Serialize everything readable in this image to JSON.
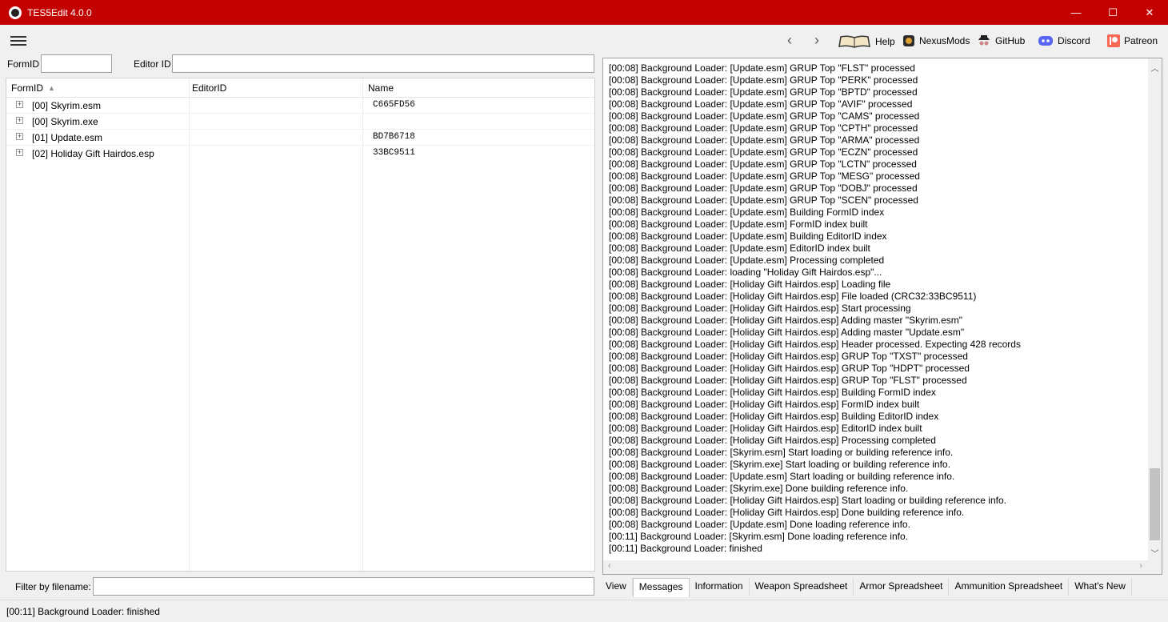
{
  "window": {
    "title": "TES5Edit 4.0.0",
    "minimize": "—",
    "maximize": "☐",
    "close": "✕"
  },
  "toolbar": {
    "back": "‹",
    "forward": "›",
    "help": "Help",
    "nexusmods": "NexusMods",
    "github": "GitHub",
    "discord": "Discord",
    "patreon": "Patreon"
  },
  "filters": {
    "formid_label": "FormID",
    "formid_value": "",
    "editorid_label": "Editor ID",
    "editorid_value": ""
  },
  "tree": {
    "columns": [
      "FormID",
      "EditorID",
      "Name"
    ],
    "sort_indicator": "▲",
    "rows": [
      {
        "name": "[00] Skyrim.esm",
        "hash": "C665FD56"
      },
      {
        "name": "[00] Skyrim.exe",
        "hash": ""
      },
      {
        "name": "[01] Update.esm",
        "hash": "BD7B6718"
      },
      {
        "name": "[02] Holiday Gift Hairdos.esp",
        "hash": "33BC9511"
      }
    ]
  },
  "filename_filter": {
    "label": "Filter by filename:",
    "value": ""
  },
  "messages": [
    "[00:08] Background Loader: [Update.esm] GRUP Top \"FLST\" processed",
    "[00:08] Background Loader: [Update.esm] GRUP Top \"PERK\" processed",
    "[00:08] Background Loader: [Update.esm] GRUP Top \"BPTD\" processed",
    "[00:08] Background Loader: [Update.esm] GRUP Top \"AVIF\" processed",
    "[00:08] Background Loader: [Update.esm] GRUP Top \"CAMS\" processed",
    "[00:08] Background Loader: [Update.esm] GRUP Top \"CPTH\" processed",
    "[00:08] Background Loader: [Update.esm] GRUP Top \"ARMA\" processed",
    "[00:08] Background Loader: [Update.esm] GRUP Top \"ECZN\" processed",
    "[00:08] Background Loader: [Update.esm] GRUP Top \"LCTN\" processed",
    "[00:08] Background Loader: [Update.esm] GRUP Top \"MESG\" processed",
    "[00:08] Background Loader: [Update.esm] GRUP Top \"DOBJ\" processed",
    "[00:08] Background Loader: [Update.esm] GRUP Top \"SCEN\" processed",
    "[00:08] Background Loader: [Update.esm] Building FormID index",
    "[00:08] Background Loader: [Update.esm] FormID index built",
    "[00:08] Background Loader: [Update.esm] Building EditorID index",
    "[00:08] Background Loader: [Update.esm] EditorID index built",
    "[00:08] Background Loader: [Update.esm] Processing completed",
    "[00:08] Background Loader: loading \"Holiday Gift Hairdos.esp\"...",
    "[00:08] Background Loader: [Holiday Gift Hairdos.esp] Loading file",
    "[00:08] Background Loader: [Holiday Gift Hairdos.esp] File loaded (CRC32:33BC9511)",
    "[00:08] Background Loader: [Holiday Gift Hairdos.esp] Start processing",
    "[00:08] Background Loader: [Holiday Gift Hairdos.esp] Adding master \"Skyrim.esm\"",
    "[00:08] Background Loader: [Holiday Gift Hairdos.esp] Adding master \"Update.esm\"",
    "[00:08] Background Loader: [Holiday Gift Hairdos.esp] Header processed. Expecting 428 records",
    "[00:08] Background Loader: [Holiday Gift Hairdos.esp] GRUP Top \"TXST\" processed",
    "[00:08] Background Loader: [Holiday Gift Hairdos.esp] GRUP Top \"HDPT\" processed",
    "[00:08] Background Loader: [Holiday Gift Hairdos.esp] GRUP Top \"FLST\" processed",
    "[00:08] Background Loader: [Holiday Gift Hairdos.esp] Building FormID index",
    "[00:08] Background Loader: [Holiday Gift Hairdos.esp] FormID index built",
    "[00:08] Background Loader: [Holiday Gift Hairdos.esp] Building EditorID index",
    "[00:08] Background Loader: [Holiday Gift Hairdos.esp] EditorID index built",
    "[00:08] Background Loader: [Holiday Gift Hairdos.esp] Processing completed",
    "[00:08] Background Loader: [Skyrim.esm] Start loading or building reference info.",
    "[00:08] Background Loader: [Skyrim.exe] Start loading or building reference info.",
    "[00:08] Background Loader: [Update.esm] Start loading or building reference info.",
    "[00:08] Background Loader: [Skyrim.exe] Done building reference info.",
    "[00:08] Background Loader: [Holiday Gift Hairdos.esp] Start loading or building reference info.",
    "[00:08] Background Loader: [Holiday Gift Hairdos.esp] Done building reference info.",
    "[00:08] Background Loader: [Update.esm] Done loading reference info.",
    "[00:11] Background Loader: [Skyrim.esm] Done loading reference info.",
    "[00:11] Background Loader: finished"
  ],
  "tabs": [
    "View",
    "Messages",
    "Information",
    "Weapon Spreadsheet",
    "Armor Spreadsheet",
    "Ammunition Spreadsheet",
    "What's New"
  ],
  "active_tab": "Messages",
  "status": "[00:11] Background Loader: finished",
  "colors": {
    "titlebar": "#c30000",
    "background": "#f0f0f0"
  }
}
